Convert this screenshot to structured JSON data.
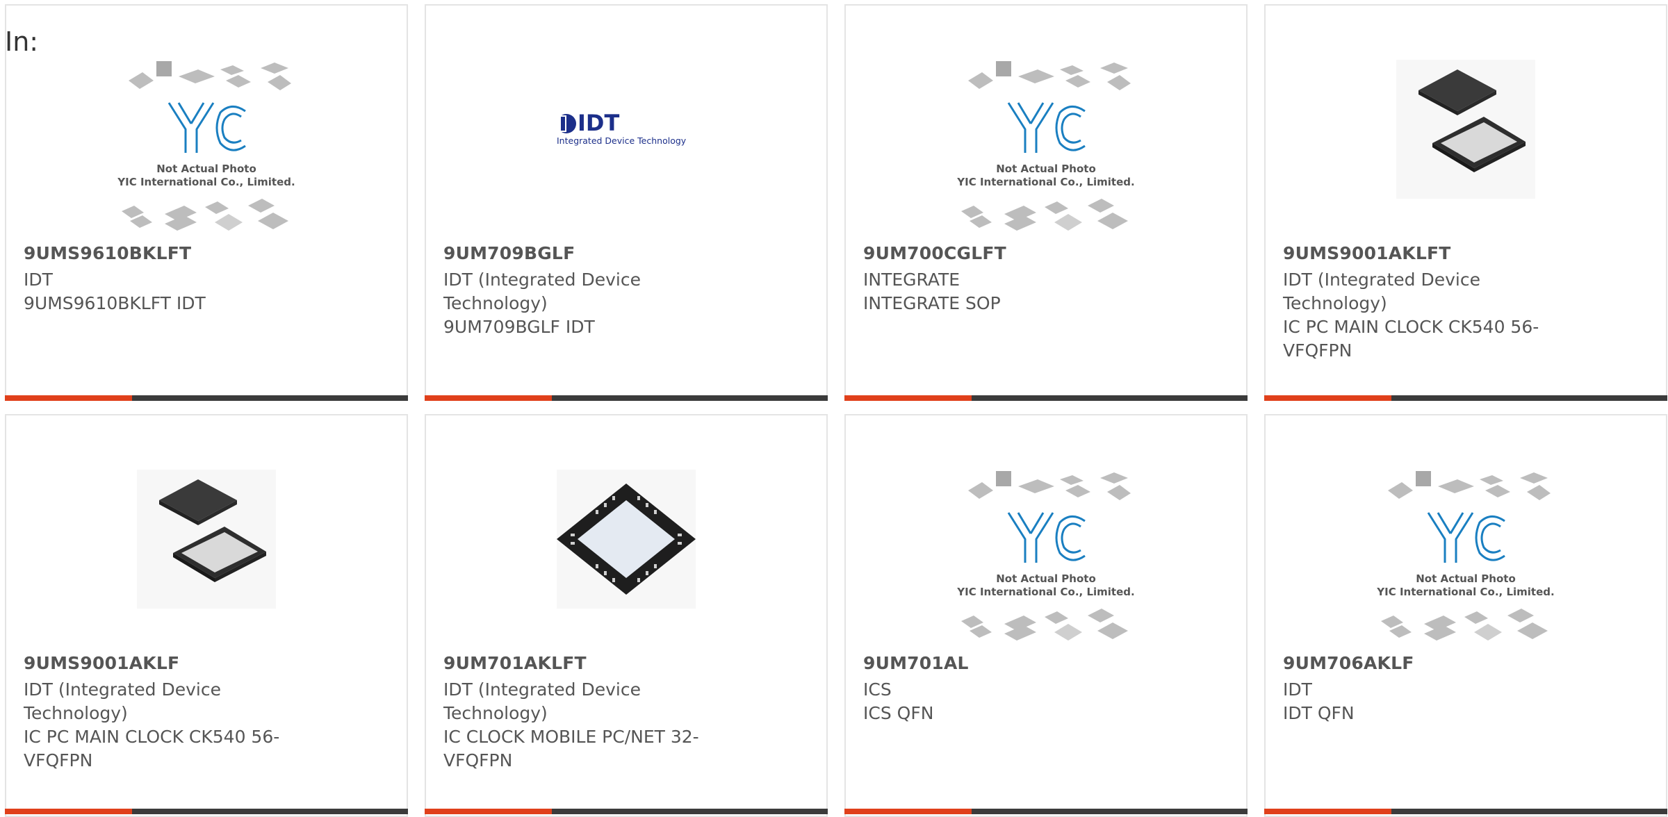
{
  "header": {
    "label": "In:"
  },
  "products": [
    {
      "part_number": "9UMS9610BKLFT",
      "manufacturer": "IDT",
      "description": "9UMS9610BKLFT IDT",
      "image": "yic-placeholder",
      "placeholder_line1": "Not Actual Photo",
      "placeholder_line2": "YIC International Co., Limited."
    },
    {
      "part_number": "9UM709BGLF",
      "manufacturer": "IDT (Integrated Device Technology)",
      "description": "9UM709BGLF IDT",
      "image": "idt-logo",
      "logo_text": "IDT",
      "logo_sub": "Integrated Device Technology"
    },
    {
      "part_number": "9UM700CGLFT",
      "manufacturer": "INTEGRATE",
      "description": "INTEGRATE SOP",
      "image": "yic-placeholder",
      "placeholder_line1": "Not Actual Photo",
      "placeholder_line2": "YIC International Co., Limited."
    },
    {
      "part_number": "9UMS9001AKLFT",
      "manufacturer": "IDT (Integrated Device Technology)",
      "description": "IC PC MAIN CLOCK CK540 56-VFQFPN",
      "image": "qfn-chip-gray"
    },
    {
      "part_number": "9UMS9001AKLF",
      "manufacturer": "IDT (Integrated Device Technology)",
      "description": "IC PC MAIN CLOCK CK540 56-VFQFPN",
      "image": "qfn-chip-gray"
    },
    {
      "part_number": "9UM701AKLFT",
      "manufacturer": "IDT (Integrated Device Technology)",
      "description": "IC CLOCK MOBILE PC/NET 32-VFQFPN",
      "image": "qfn-chip-black"
    },
    {
      "part_number": "9UM701AL",
      "manufacturer": "ICS",
      "description": "ICS QFN",
      "image": "yic-placeholder",
      "placeholder_line1": "Not Actual Photo",
      "placeholder_line2": "YIC International Co., Limited."
    },
    {
      "part_number": "9UM706AKLF",
      "manufacturer": "IDT",
      "description": "IDT QFN",
      "image": "yic-placeholder",
      "placeholder_line1": "Not Actual Photo",
      "placeholder_line2": "YIC International Co., Limited."
    }
  ],
  "colors": {
    "accent": "#e0401b",
    "bar": "#3b3b3b",
    "text": "#555555",
    "yic_blue": "#1a7fc1",
    "idt_blue": "#1c2f8a"
  }
}
